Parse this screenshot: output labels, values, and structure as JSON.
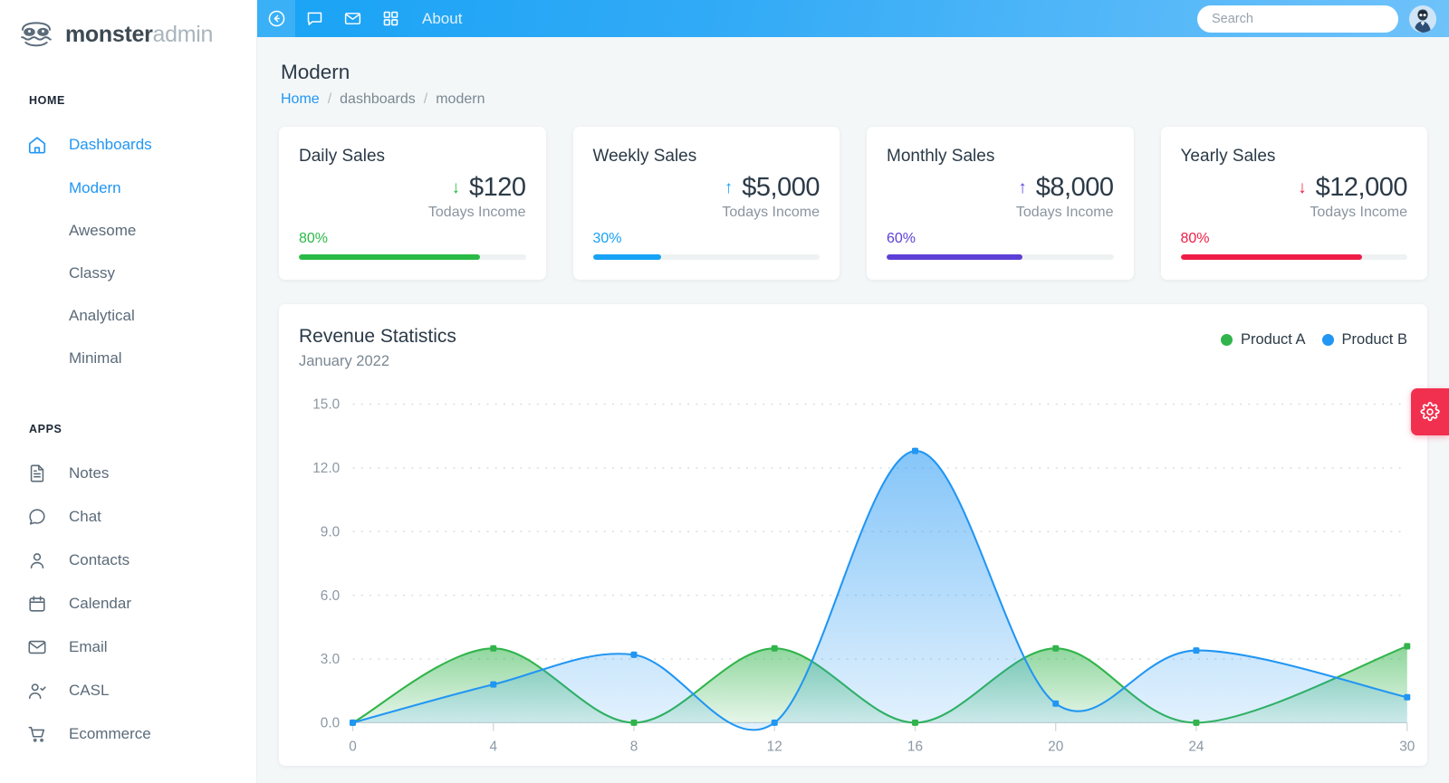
{
  "brand": {
    "bold": "monster",
    "light": "admin",
    "logo_icon": "monster-face-logo"
  },
  "topbar": {
    "icons": [
      {
        "name": "back-circle-icon",
        "selected": true
      },
      {
        "name": "chat-bubble-icon",
        "selected": false
      },
      {
        "name": "envelope-icon",
        "selected": false
      },
      {
        "name": "grid-apps-icon",
        "selected": false
      }
    ],
    "about_label": "About",
    "search_placeholder": "Search",
    "search_value": "",
    "avatar_icon": "user-avatar"
  },
  "sidebar": {
    "sections": [
      {
        "label": "HOME",
        "items": [
          {
            "label": "Dashboards",
            "icon": "home-icon",
            "active": true
          }
        ],
        "subitems": [
          {
            "label": "Modern",
            "active": true
          },
          {
            "label": "Awesome",
            "active": false
          },
          {
            "label": "Classy",
            "active": false
          },
          {
            "label": "Analytical",
            "active": false
          },
          {
            "label": "Minimal",
            "active": false
          }
        ]
      },
      {
        "label": "APPS",
        "items": [
          {
            "label": "Notes",
            "icon": "notes-icon",
            "active": false
          },
          {
            "label": "Chat",
            "icon": "chat-icon",
            "active": false
          },
          {
            "label": "Contacts",
            "icon": "contacts-icon",
            "active": false
          },
          {
            "label": "Calendar",
            "icon": "calendar-icon",
            "active": false
          },
          {
            "label": "Email",
            "icon": "email-icon",
            "active": false
          },
          {
            "label": "CASL",
            "icon": "user-check-icon",
            "active": false
          },
          {
            "label": "Ecommerce",
            "icon": "cart-icon",
            "active": false
          }
        ],
        "subitems": []
      }
    ]
  },
  "page": {
    "title": "Modern",
    "breadcrumb": {
      "home": "Home",
      "sep1": "/",
      "level1": "dashboards",
      "sep2": "/",
      "level2": "modern"
    }
  },
  "cards": [
    {
      "title": "Daily Sales",
      "arrow": "↓",
      "value": "$120",
      "subtitle": "Todays Income",
      "percent_label": "80%",
      "percent": 80,
      "color": "#29ba46"
    },
    {
      "title": "Weekly Sales",
      "arrow": "↑",
      "value": "$5,000",
      "subtitle": "Todays Income",
      "percent_label": "30%",
      "percent": 30,
      "color": "#17a2f5"
    },
    {
      "title": "Monthly Sales",
      "arrow": "↑",
      "value": "$8,000",
      "subtitle": "Todays Income",
      "percent_label": "60%",
      "percent": 60,
      "color": "#5d3fd6"
    },
    {
      "title": "Yearly Sales",
      "arrow": "↓",
      "value": "$12,000",
      "subtitle": "Todays Income",
      "percent_label": "80%",
      "percent": 80,
      "color": "#ef1d46"
    }
  ],
  "fab": {
    "icon": "gear-icon",
    "color": "#f1304f"
  },
  "chart_data": {
    "type": "area",
    "title": "Revenue Statistics",
    "subtitle": "January 2022",
    "xlabel": "",
    "ylabel": "",
    "xlim": [
      0,
      30
    ],
    "ylim": [
      0,
      15
    ],
    "grid": true,
    "legend_position": "top-right",
    "xticks": [
      0,
      4,
      8,
      12,
      16,
      20,
      24,
      30
    ],
    "xtick_labels": [
      "0",
      "4",
      "8",
      "12",
      "16",
      "20",
      "24",
      "30"
    ],
    "yticks": [
      0,
      3,
      6,
      9,
      12,
      15
    ],
    "ytick_labels": [
      "0.0",
      "3.0",
      "6.0",
      "9.0",
      "12.0",
      "15.0"
    ],
    "x": [
      0,
      4,
      8,
      12,
      16,
      20,
      24,
      30
    ],
    "series": [
      {
        "name": "Product A",
        "color": "#31b44b",
        "values": [
          0,
          3.5,
          0,
          3.5,
          0,
          3.5,
          0,
          3.6
        ]
      },
      {
        "name": "Product B",
        "color": "#2196f3",
        "values": [
          0,
          1.8,
          3.2,
          0,
          12.8,
          0.9,
          3.4,
          1.2
        ]
      }
    ]
  }
}
